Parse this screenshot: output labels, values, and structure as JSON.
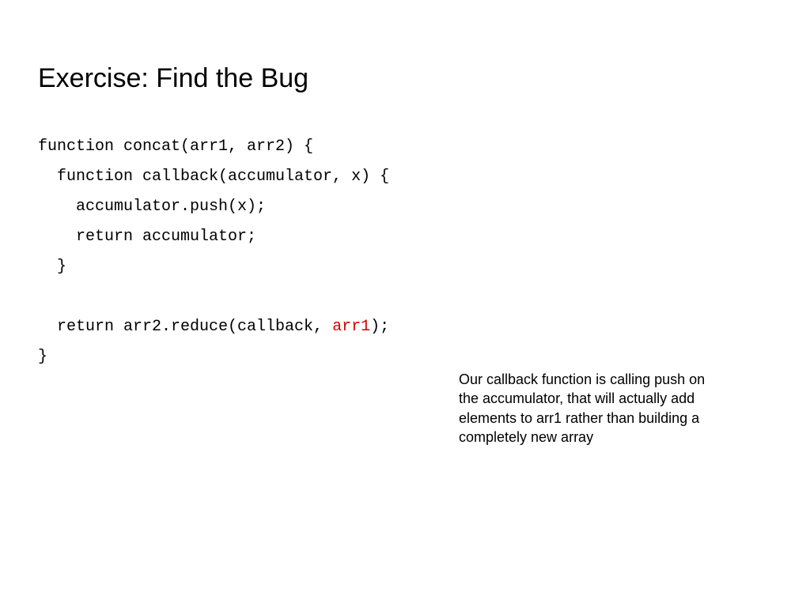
{
  "title": "Exercise: Find the Bug",
  "code": {
    "line1": "function concat(arr1, arr2) {",
    "line2": "  function callback(accumulator, x) {",
    "line3": "    accumulator.push(x);",
    "line4": "    return accumulator;",
    "line5": "  }",
    "line6": "",
    "line7_prefix": "  return arr2.reduce(callback, ",
    "line7_highlight": "arr1",
    "line7_suffix": ");",
    "line8": "}"
  },
  "explanation": "Our callback function is calling push on the accumulator, that will actually add elements to arr1 rather than building a completely new array"
}
